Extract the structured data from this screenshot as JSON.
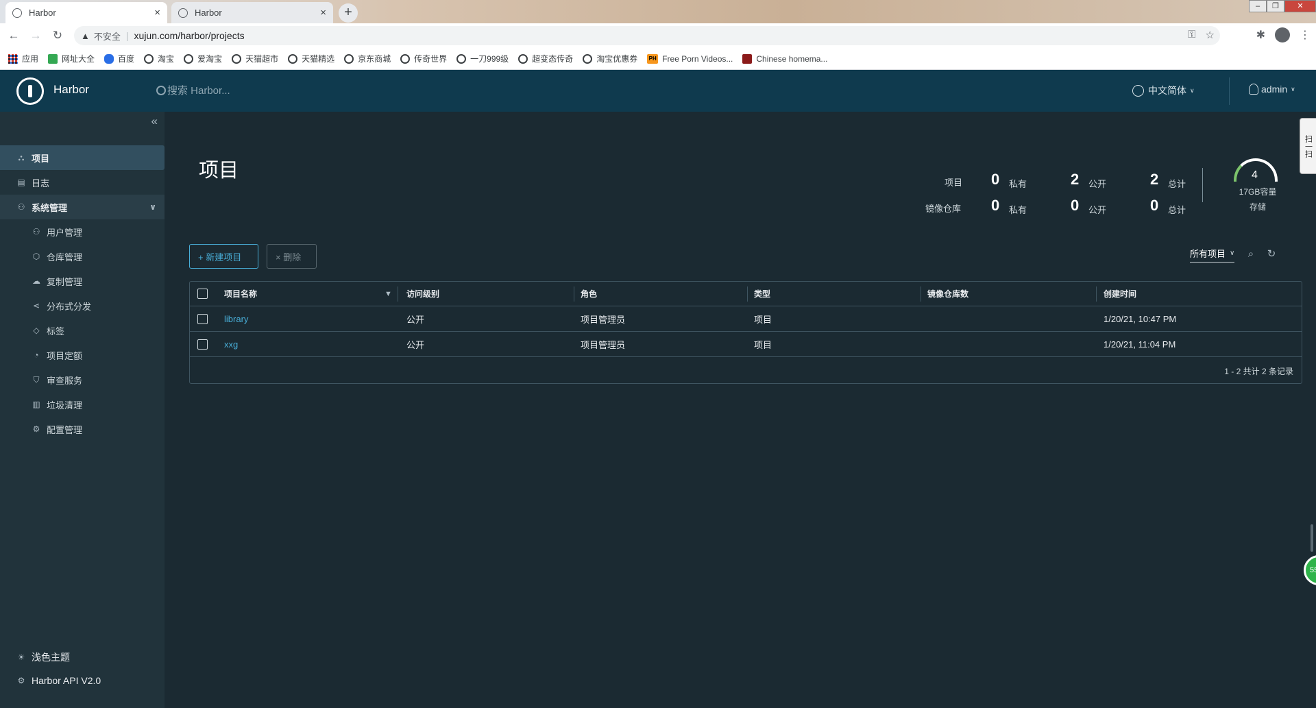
{
  "browser": {
    "tabs": [
      {
        "title": "Harbor",
        "close": "×"
      },
      {
        "title": "Harbor",
        "close": "×"
      }
    ],
    "new_tab": "+",
    "security_label": "不安全",
    "url": "xujun.com/harbor/projects",
    "bookmarks": [
      {
        "label": "应用",
        "icon": "apps-icon"
      },
      {
        "label": "网址大全",
        "icon": "green-square-icon"
      },
      {
        "label": "百度",
        "icon": "baidu-paw-icon"
      },
      {
        "label": "淘宝",
        "icon": "globe-icon"
      },
      {
        "label": "爱淘宝",
        "icon": "globe-icon"
      },
      {
        "label": "天猫超市",
        "icon": "globe-icon"
      },
      {
        "label": "天猫精选",
        "icon": "globe-icon"
      },
      {
        "label": "京东商城",
        "icon": "globe-icon"
      },
      {
        "label": "传奇世界",
        "icon": "globe-icon"
      },
      {
        "label": "一刀999级",
        "icon": "globe-icon"
      },
      {
        "label": "超变态传奇",
        "icon": "globe-icon"
      },
      {
        "label": "淘宝优惠券",
        "icon": "globe-icon"
      },
      {
        "label": "Free Porn Videos...",
        "icon": "ph-icon",
        "badge": "PH"
      },
      {
        "label": "Chinese homema...",
        "icon": "red-thumb-icon"
      }
    ]
  },
  "header": {
    "brand": "Harbor",
    "search_placeholder": "搜索 Harbor...",
    "language": "中文简体",
    "user": "admin"
  },
  "sidebar": {
    "items": [
      {
        "label": "项目",
        "icon": "projects-icon",
        "active": true
      },
      {
        "label": "日志",
        "icon": "log-icon"
      },
      {
        "label": "系统管理",
        "icon": "admin-icon",
        "expanded": true
      }
    ],
    "sub_items": [
      {
        "label": "用户管理",
        "icon": "users-icon"
      },
      {
        "label": "仓库管理",
        "icon": "registry-icon"
      },
      {
        "label": "复制管理",
        "icon": "replication-icon"
      },
      {
        "label": "分布式分发",
        "icon": "distribution-icon"
      },
      {
        "label": "标签",
        "icon": "tag-icon"
      },
      {
        "label": "项目定额",
        "icon": "quota-icon"
      },
      {
        "label": "审查服务",
        "icon": "shield-icon"
      },
      {
        "label": "垃圾清理",
        "icon": "trash-icon"
      },
      {
        "label": "配置管理",
        "icon": "gear-icon"
      }
    ],
    "theme_label": "浅色主题",
    "api_label": "Harbor API V2.0"
  },
  "page": {
    "title": "项目",
    "stats": {
      "projects_label": "项目",
      "repos_label": "镜像仓库",
      "private_label": "私有",
      "public_label": "公开",
      "total_label": "总计",
      "projects_private": "0",
      "projects_public": "2",
      "projects_total": "2",
      "repos_private": "0",
      "repos_public": "0",
      "repos_total": "0"
    },
    "storage": {
      "value": "4",
      "capacity": "17GB容量",
      "label": "存储"
    },
    "new_project_button": "+ 新建项目",
    "delete_button": "× 删除",
    "filter_value": "所有项目",
    "table": {
      "columns": [
        "项目名称",
        "访问级别",
        "角色",
        "类型",
        "镜像仓库数",
        "创建时间"
      ],
      "rows": [
        {
          "name": "library",
          "access": "公开",
          "role": "项目管理员",
          "type": "项目",
          "repos": "",
          "created": "1/20/21, 10:47 PM"
        },
        {
          "name": "xxg",
          "access": "公开",
          "role": "项目管理员",
          "type": "项目",
          "repos": "",
          "created": "1/20/21, 11:04 PM"
        }
      ],
      "footer": "1 - 2 共计 2 条记录"
    }
  },
  "overlay": {
    "side_tab": "扫一扫",
    "bubble": "55"
  }
}
